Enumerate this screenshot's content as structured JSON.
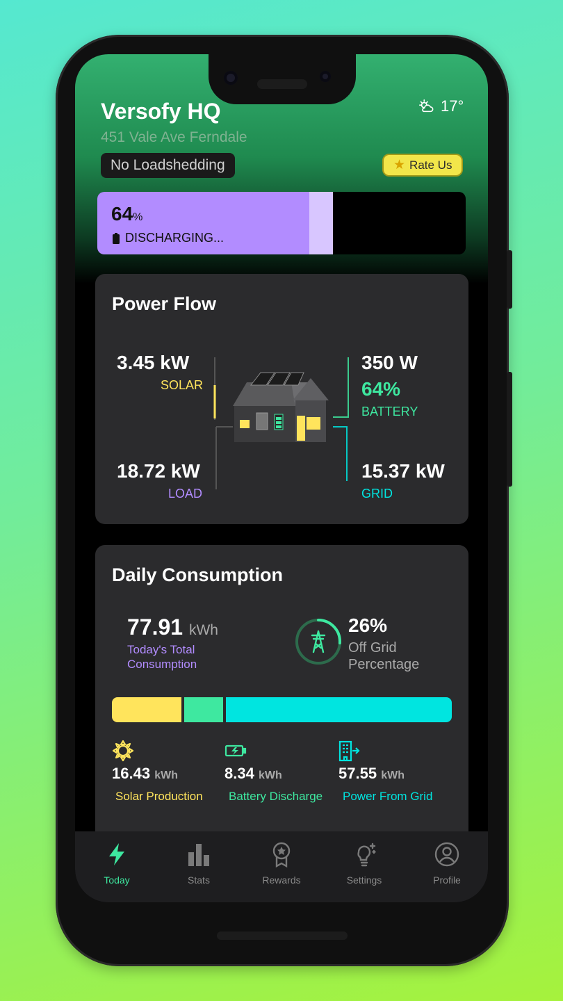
{
  "header": {
    "site_name": "Versofy HQ",
    "address": "451 Vale Ave Ferndale",
    "temperature": "17°",
    "weather_icon": "partly-cloudy-icon",
    "loadshedding_status": "No Loadshedding",
    "rate_button_label": "Rate Us"
  },
  "battery_banner": {
    "percent": "64",
    "percent_unit": "%",
    "state": "DISCHARGING...",
    "level": 0.64
  },
  "power_flow": {
    "title": "Power Flow",
    "solar": {
      "value": "3.45 kW",
      "label": "SOLAR"
    },
    "battery": {
      "value": "350 W",
      "percent": "64%",
      "label": "BATTERY"
    },
    "load": {
      "value": "18.72 kW",
      "label": "LOAD"
    },
    "grid": {
      "value": "15.37 kW",
      "label": "GRID"
    }
  },
  "daily_consumption": {
    "title": "Daily Consumption",
    "total_value": "77.91",
    "total_unit": "kWh",
    "total_label": "Today's Total Consumption",
    "off_grid_percent": "26%",
    "off_grid_label": "Off Grid Percentage",
    "off_grid_fraction": 0.26,
    "breakdown": [
      {
        "value": "16.43",
        "unit": "kWh",
        "label": "Solar Production",
        "color": "#ffe45c",
        "icon": "sun-icon"
      },
      {
        "value": "8.34",
        "unit": "kWh",
        "label": "Battery Discharge",
        "color": "#3ee8a0",
        "icon": "battery-charging-icon"
      },
      {
        "value": "57.55",
        "unit": "kWh",
        "label": "Power From Grid",
        "color": "#00e5e0",
        "icon": "grid-building-icon"
      }
    ]
  },
  "colors": {
    "solar": "#ffe45c",
    "battery": "#3ee8a0",
    "load": "#b28cff",
    "grid": "#00e5e0",
    "accent": "#3ee8a0"
  },
  "tabs": [
    {
      "label": "Today",
      "icon": "lightning-icon",
      "active": true
    },
    {
      "label": "Stats",
      "icon": "bar-chart-icon",
      "active": false
    },
    {
      "label": "Rewards",
      "icon": "award-ribbon-icon",
      "active": false
    },
    {
      "label": "Settings",
      "icon": "lightbulb-icon",
      "active": false
    },
    {
      "label": "Profile",
      "icon": "user-circle-icon",
      "active": false
    }
  ]
}
